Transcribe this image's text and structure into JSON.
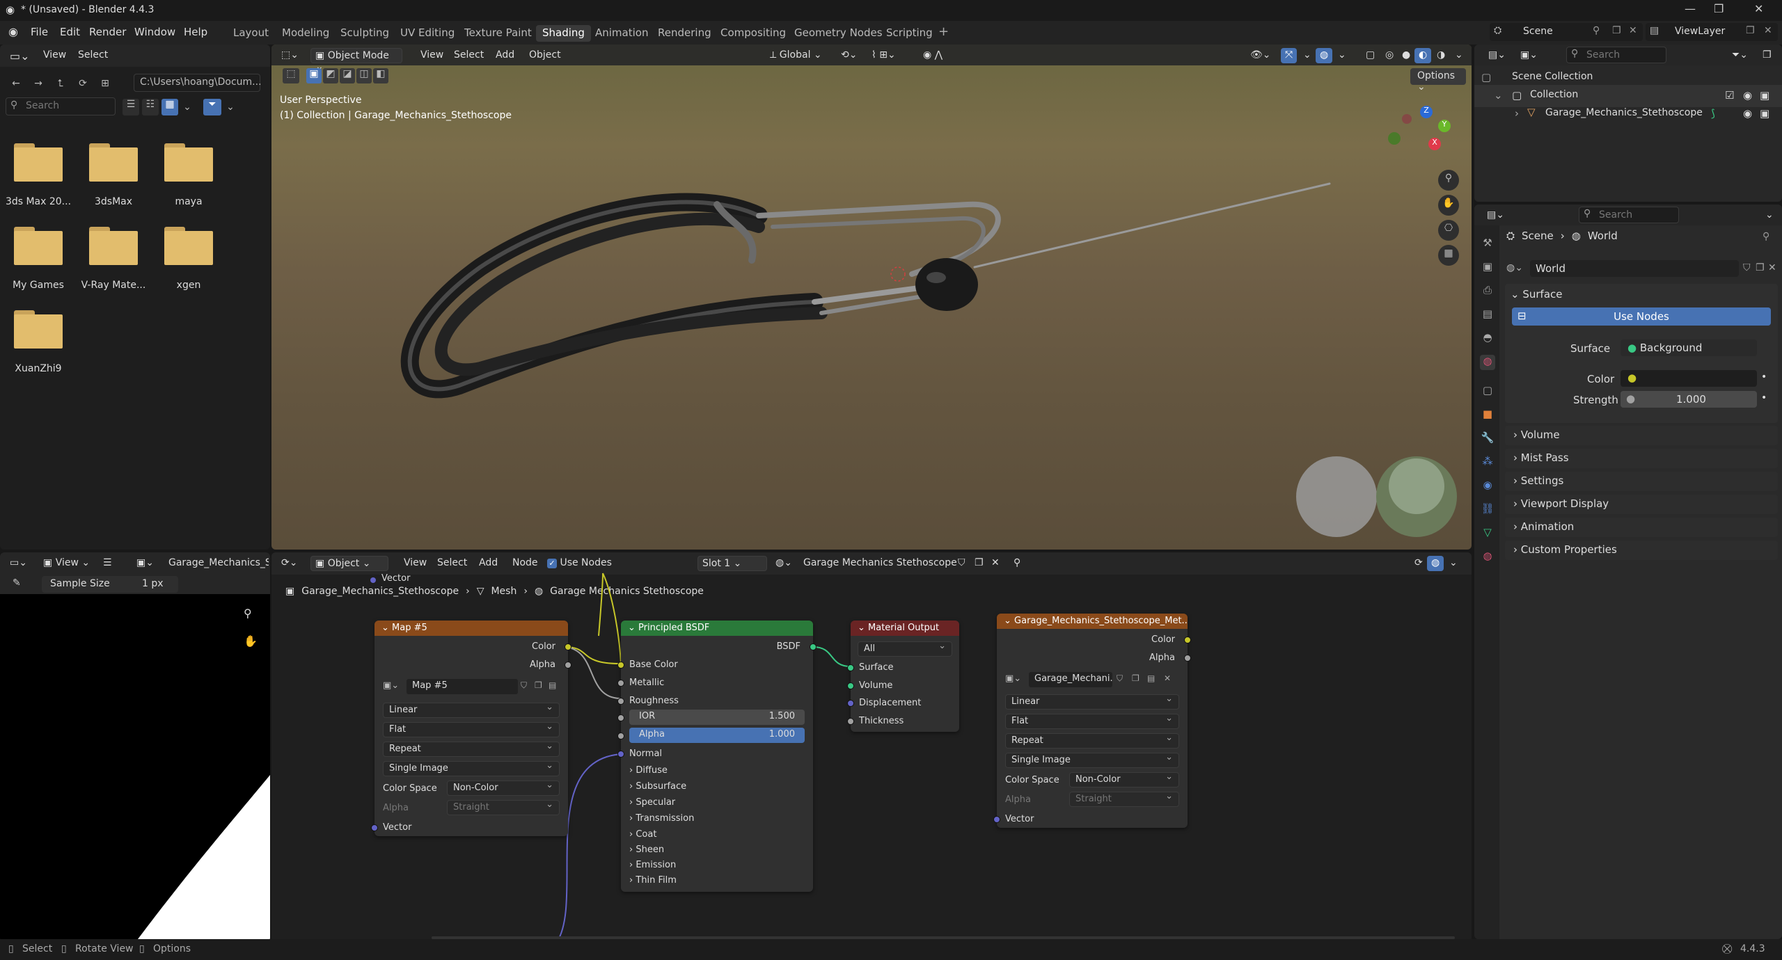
{
  "window": {
    "title": "* (Unsaved) - Blender 4.4.3"
  },
  "menu": {
    "items": [
      "File",
      "Edit",
      "Render",
      "Window",
      "Help"
    ]
  },
  "workspaces": [
    "Layout",
    "Modeling",
    "Sculpting",
    "UV Editing",
    "Texture Paint",
    "Shading",
    "Animation",
    "Rendering",
    "Compositing",
    "Geometry Nodes",
    "Scripting"
  ],
  "active_workspace": "Shading",
  "scene": {
    "scene_name": "Scene",
    "view_layer": "ViewLayer"
  },
  "file_browser": {
    "view_label": "View",
    "select_label": "Select",
    "path": "C:\\Users\\hoang\\Docum...",
    "search_placeholder": "Search",
    "folders": [
      "3ds Max 20...",
      "3dsMax",
      "maya",
      "My Games",
      "V-Ray Mate...",
      "xgen",
      "XuanZhi9"
    ]
  },
  "viewport": {
    "mode": "Object Mode",
    "menus": [
      "View",
      "Select",
      "Add",
      "Object"
    ],
    "transform_orientation": "Global",
    "options_label": "Options",
    "overlay_line1": "User Perspective",
    "overlay_line2": "(1) Collection | Garage_Mechanics_Stethoscope",
    "gizmo_axes": {
      "z": "Z",
      "y": "Y",
      "x": "X"
    }
  },
  "image_editor": {
    "view_label": "View",
    "image_name": "Garage_Mechanics_Ste",
    "sample_size_label": "Sample Size",
    "sample_size_value": "1 px"
  },
  "node_editor": {
    "object_label": "Object",
    "menus": [
      "View",
      "Select",
      "Add",
      "Node"
    ],
    "use_nodes_label": "Use Nodes",
    "slot": "Slot 1",
    "material": "Garage Mechanics Stethoscope",
    "breadcrumb": [
      "Garage_Mechanics_Stethoscope",
      "Mesh",
      "Garage Mechanics Stethoscope"
    ],
    "vector_label": "Vector",
    "map_node": {
      "title": "Map #5",
      "outputs": [
        "Color",
        "Alpha"
      ],
      "image_name": "Map #5",
      "interpolation": "Linear",
      "projection": "Flat",
      "extension": "Repeat",
      "source": "Single Image",
      "color_space_label": "Color Space",
      "color_space": "Non-Color",
      "alpha_label": "Alpha",
      "alpha_mode": "Straight",
      "input": "Vector"
    },
    "bsdf_node": {
      "title": "Principled BSDF",
      "output": "BSDF",
      "inputs": [
        "Base Color",
        "Metallic",
        "Roughness"
      ],
      "ior_label": "IOR",
      "ior_value": "1.500",
      "alpha_label": "Alpha",
      "alpha_value": "1.000",
      "normal": "Normal",
      "panels": [
        "Diffuse",
        "Subsurface",
        "Specular",
        "Transmission",
        "Coat",
        "Sheen",
        "Emission",
        "Thin Film"
      ]
    },
    "output_node": {
      "title": "Material Output",
      "target": "All",
      "inputs": [
        "Surface",
        "Volume",
        "Displacement",
        "Thickness"
      ]
    },
    "tex_node": {
      "title": "Garage_Mechanics_Stethoscope_Met...",
      "outputs": [
        "Color",
        "Alpha"
      ],
      "image_name": "Garage_Mechani...",
      "interpolation": "Linear",
      "projection": "Flat",
      "extension": "Repeat",
      "source": "Single Image",
      "color_space_label": "Color Space",
      "color_space": "Non-Color",
      "alpha_label": "Alpha",
      "alpha_mode": "Straight",
      "input": "Vector"
    }
  },
  "outliner": {
    "search_placeholder": "Search",
    "scene_collection": "Scene Collection",
    "collection": "Collection",
    "object": "Garage_Mechanics_Stethoscope"
  },
  "properties": {
    "search_placeholder": "Search",
    "breadcrumb": [
      "Scene",
      "World"
    ],
    "world_name": "World",
    "surface_section": "Surface",
    "use_nodes_button": "Use Nodes",
    "surface_label": "Surface",
    "surface_value": "Background",
    "color_label": "Color",
    "strength_label": "Strength",
    "strength_value": "1.000",
    "collapsed_sections": [
      "Volume",
      "Mist Pass",
      "Settings",
      "Viewport Display",
      "Animation",
      "Custom Properties"
    ]
  },
  "statusbar": {
    "select": "Select",
    "rotate": "Rotate View",
    "options": "Options",
    "version": "4.4.3"
  },
  "colors": {
    "accent": "#4772b3",
    "bsdf_header": "#2a7a3a",
    "tex_header": "#8a4a1a",
    "output_header": "#6a2424",
    "socket_yellow": "#c7c729",
    "socket_gray": "#a1a1a1",
    "socket_purple": "#6363c7",
    "socket_green": "#39c884"
  }
}
